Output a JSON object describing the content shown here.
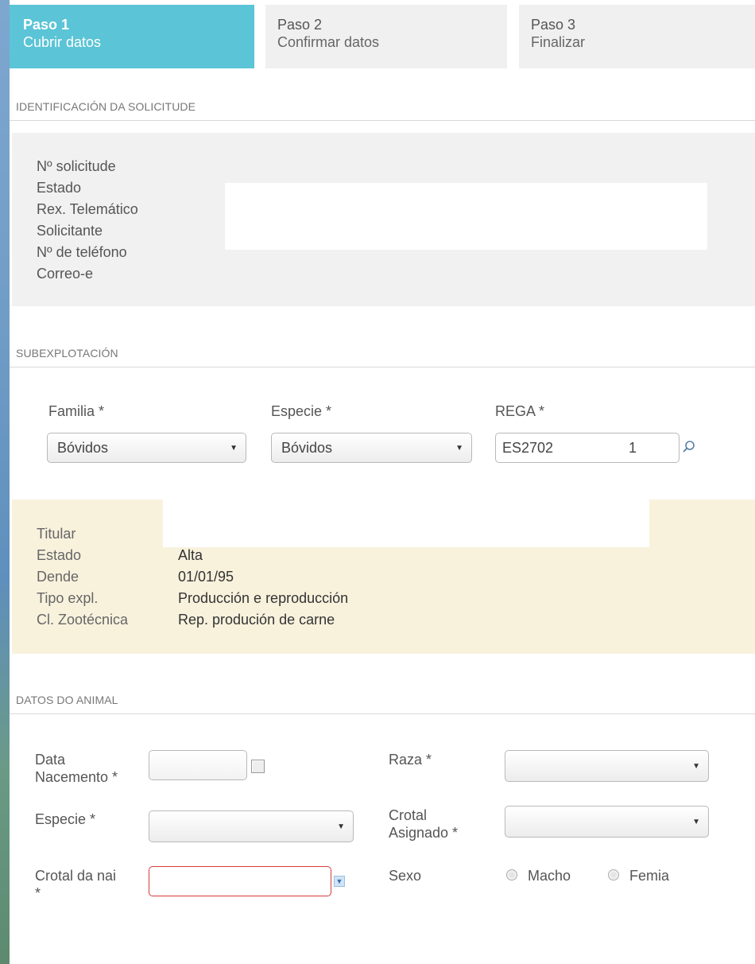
{
  "steps": [
    {
      "num": "Paso 1",
      "label": "Cubrir datos"
    },
    {
      "num": "Paso 2",
      "label": "Confirmar datos"
    },
    {
      "num": "Paso 3",
      "label": "Finalizar"
    }
  ],
  "identificacion": {
    "title": "IDENTIFICACIÓN DA SOLICITUDE",
    "fields": [
      "Nº solicitude",
      "Estado",
      "Rex. Telemático",
      "Solicitante",
      "Nº de teléfono",
      "Correo-e"
    ]
  },
  "subexplotacion": {
    "title": "SUBEXPLOTACIÓN",
    "familia_label": "Familia *",
    "familia_value": "Bóvidos",
    "especie_label": "Especie *",
    "especie_value": "Bóvidos",
    "rega_label": "REGA *",
    "rega_value": "ES2702      1",
    "titular": {
      "rows": [
        {
          "k": "Titular",
          "v": ""
        },
        {
          "k": "Estado",
          "v": "Alta"
        },
        {
          "k": "Dende",
          "v": "01/01/95"
        },
        {
          "k": "Tipo expl.",
          "v": "Producción e reproducción"
        },
        {
          "k": "Cl. Zootécnica",
          "v": "Rep. produción de carne"
        }
      ]
    }
  },
  "animal": {
    "title": "DATOS DO ANIMAL",
    "data_nacemento_label_1": "Data",
    "data_nacemento_label_2": "Nacemento *",
    "raza_label": "Raza *",
    "especie_label": "Especie *",
    "crotal_asignado_label_1": "Crotal",
    "crotal_asignado_label_2": "Asignado *",
    "crotal_nai_label_1": "Crotal da nai",
    "crotal_nai_label_2": "*",
    "sexo_label": "Sexo",
    "sexo_options": [
      "Macho",
      "Femia"
    ]
  }
}
